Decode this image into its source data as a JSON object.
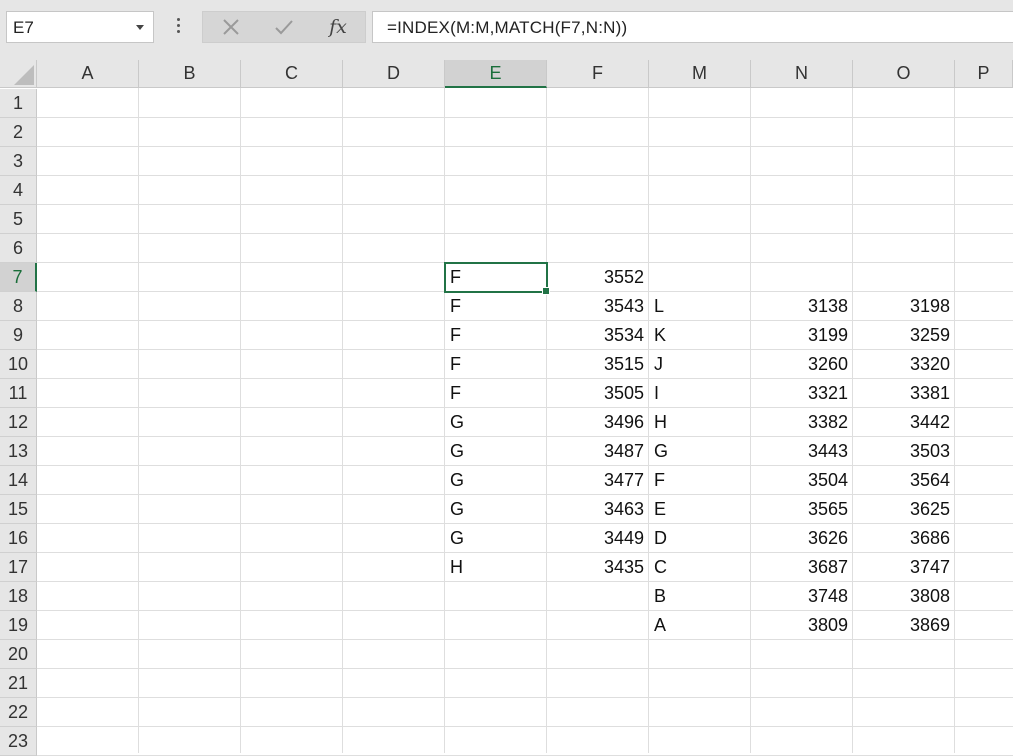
{
  "name_box": {
    "value": "E7"
  },
  "formula_bar": {
    "value": "=INDEX(M:M,MATCH(F7,N:N))"
  },
  "icons": {
    "cancel": "close-icon",
    "enter": "check-icon",
    "function": "fx-icon",
    "more": "vertical-dots-icon",
    "dropdown": "chevron-down-icon"
  },
  "colors": {
    "accent": "#217346",
    "header_bg": "#e6e6e6",
    "gridline": "#dedede"
  },
  "function_label": "fx",
  "columns": [
    "A",
    "B",
    "C",
    "D",
    "E",
    "F",
    "M",
    "N",
    "O",
    "P"
  ],
  "active_column": "E",
  "rows": [
    "1",
    "2",
    "3",
    "4",
    "5",
    "6",
    "7",
    "8",
    "9",
    "10",
    "11",
    "12",
    "13",
    "14",
    "15",
    "16",
    "17",
    "18",
    "19",
    "20",
    "21",
    "22",
    "23"
  ],
  "active_row": "7",
  "active_cell": "E7",
  "cells": {
    "E": [
      "",
      "",
      "",
      "",
      "",
      "",
      "F",
      "F",
      "F",
      "F",
      "F",
      "G",
      "G",
      "G",
      "G",
      "G",
      "H",
      "",
      "",
      "",
      "",
      "",
      ""
    ],
    "F": [
      "",
      "",
      "",
      "",
      "",
      "",
      "3552",
      "3543",
      "3534",
      "3515",
      "3505",
      "3496",
      "3487",
      "3477",
      "3463",
      "3449",
      "3435",
      "",
      "",
      "",
      "",
      "",
      ""
    ],
    "M": [
      "",
      "",
      "",
      "",
      "",
      "",
      "",
      "L",
      "K",
      "J",
      "I",
      "H",
      "G",
      "F",
      "E",
      "D",
      "C",
      "B",
      "A",
      "",
      "",
      "",
      ""
    ],
    "N": [
      "",
      "",
      "",
      "",
      "",
      "",
      "",
      "3138",
      "3199",
      "3260",
      "3321",
      "3382",
      "3443",
      "3504",
      "3565",
      "3626",
      "3687",
      "3748",
      "3809",
      "",
      "",
      "",
      ""
    ],
    "O": [
      "",
      "",
      "",
      "",
      "",
      "",
      "",
      "3198",
      "3259",
      "3320",
      "3381",
      "3442",
      "3503",
      "3564",
      "3625",
      "3686",
      "3747",
      "3808",
      "3869",
      "",
      "",
      "",
      ""
    ]
  }
}
